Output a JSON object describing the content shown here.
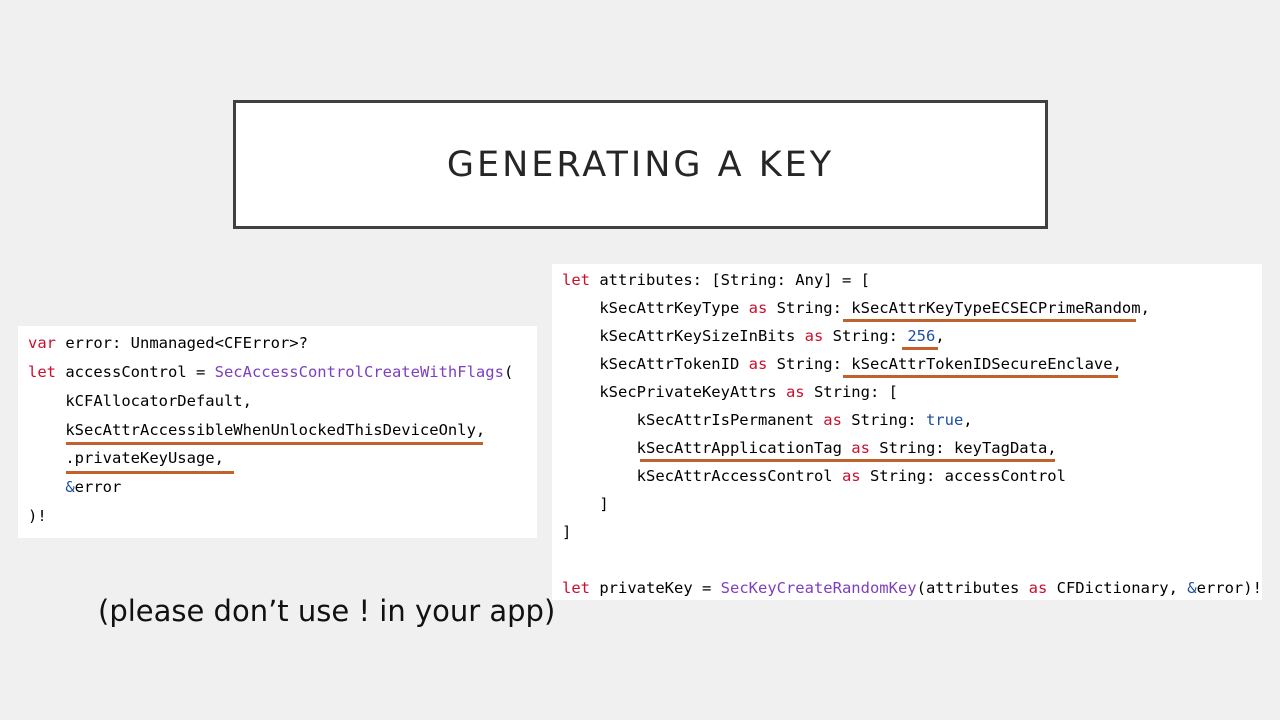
{
  "slide": {
    "title": "GENERATING A KEY",
    "note": "(please don’t use ! in your app)"
  },
  "left_code": {
    "l1": [
      "var",
      " error: Unmanaged<CFError>?"
    ],
    "l2": [
      "let",
      " accessControl = ",
      "SecAccessControlCreateWithFlags",
      "("
    ],
    "l3": "    kCFAllocatorDefault,",
    "l4": "    kSecAttrAccessibleWhenUnlockedThisDeviceOnly,",
    "l5": "    .privateKeyUsage,",
    "l6": [
      "    ",
      "&",
      "error"
    ],
    "l7": ")!"
  },
  "right_code": {
    "l1": [
      "let",
      " attributes: [String: Any] = ["
    ],
    "l2": [
      "    kSecAttrKeyType ",
      "as",
      " String: kSecAttrKeyTypeECSECPrimeRandom,"
    ],
    "l3": [
      "    kSecAttrKeySizeInBits ",
      "as",
      " String: ",
      "256",
      ","
    ],
    "l4": [
      "    kSecAttrTokenID ",
      "as",
      " String: kSecAttrTokenIDSecureEnclave,"
    ],
    "l5": [
      "    kSecPrivateKeyAttrs ",
      "as",
      " String: ["
    ],
    "l6": [
      "        kSecAttrIsPermanent ",
      "as",
      " String: ",
      "true",
      ","
    ],
    "l7": [
      "        kSecAttrApplicationTag ",
      "as",
      " String: keyTagData,"
    ],
    "l8": [
      "        kSecAttrAccessControl ",
      "as",
      " String: accessControl"
    ],
    "l9": "    ]",
    "l10": "]",
    "l11": [
      "let",
      " privateKey = ",
      "SecKeyCreateRandomKey",
      "(attributes ",
      "as",
      " CFDictionary, ",
      "&",
      "error)!"
    ]
  },
  "colors": {
    "keyword": "#c8102e",
    "function": "#7d3fbf",
    "literal": "#1c4fa0",
    "underline": "#c0622b"
  }
}
